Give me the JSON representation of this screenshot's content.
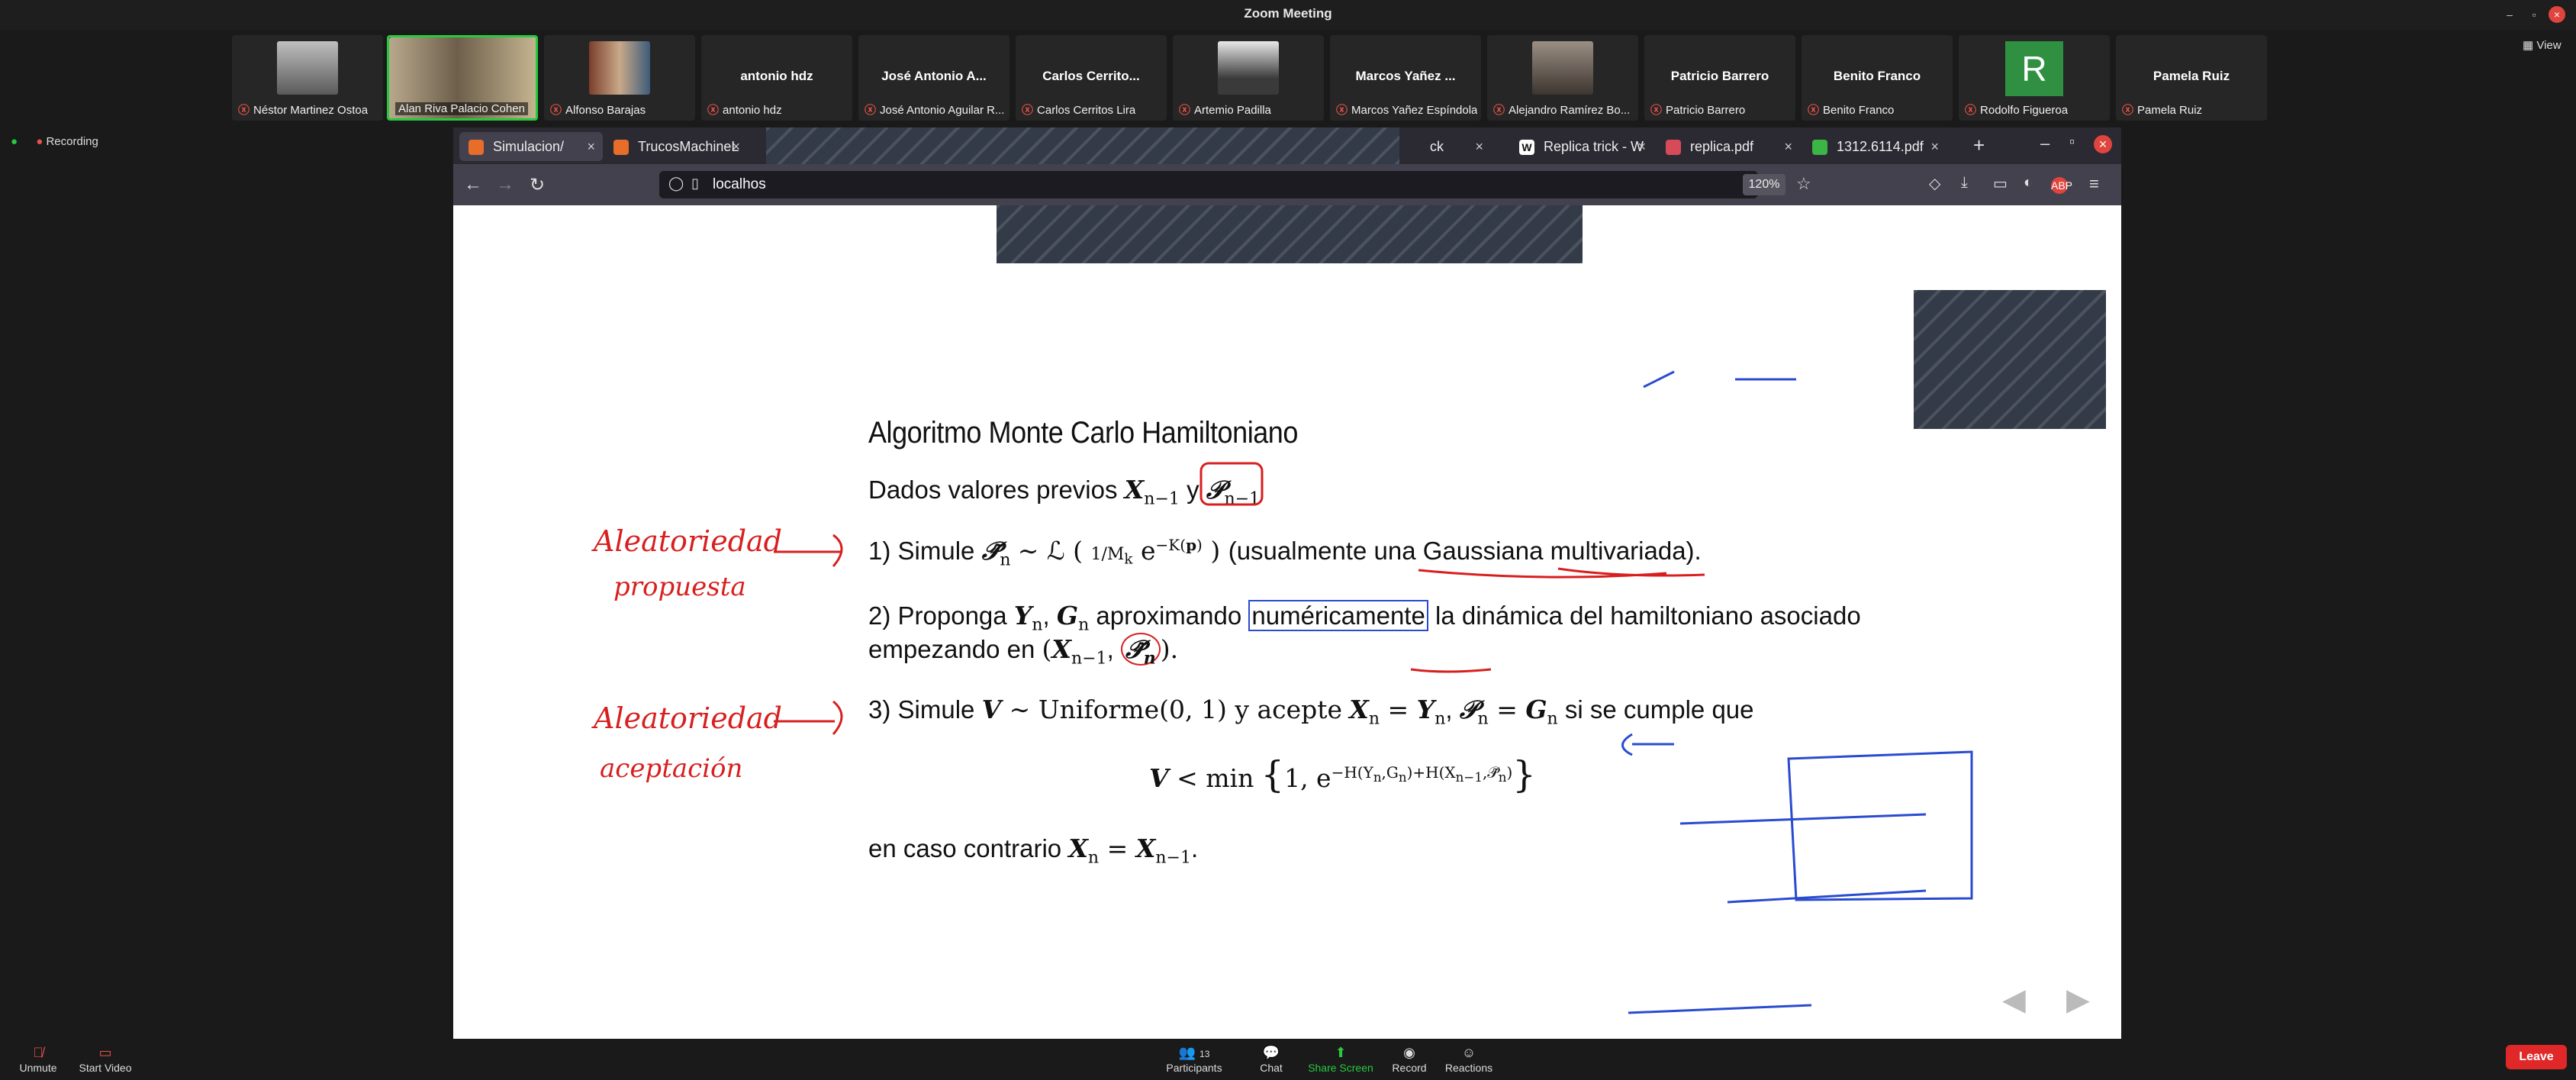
{
  "window": {
    "title": "Zoom Meeting"
  },
  "participants": [
    {
      "name": "Néstor Martinez Ostoa",
      "video": true,
      "muted": true
    },
    {
      "name": "Alan Riva Palacio Cohen",
      "video": true,
      "muted": false,
      "active": true
    },
    {
      "name": "Alfonso Barajas",
      "video": true,
      "muted": true
    },
    {
      "name": "antonio hdz",
      "video": false,
      "muted": true,
      "display_name": "antonio hdz"
    },
    {
      "name": "José Antonio Aguilar R...",
      "video": false,
      "muted": true,
      "display_name": "José Antonio A..."
    },
    {
      "name": "Carlos Cerritos Lira",
      "video": false,
      "muted": true,
      "display_name": "Carlos Cerrito..."
    },
    {
      "name": "Artemio Padilla",
      "video": true,
      "muted": true
    },
    {
      "name": "Marcos Yañez Espíndola",
      "video": false,
      "muted": true,
      "display_name": "Marcos Yañez ..."
    },
    {
      "name": "Alejandro Ramírez Bo...",
      "video": true,
      "muted": true
    },
    {
      "name": "Patricio Barrero",
      "video": false,
      "muted": true,
      "display_name": "Patricio Barrero"
    },
    {
      "name": "Benito Franco",
      "video": false,
      "muted": true,
      "display_name": "Benito Franco"
    },
    {
      "name": "Rodolfo Figueroa",
      "video": false,
      "muted": true,
      "avatar_letter": "R"
    },
    {
      "name": "Pamela Ruiz",
      "video": false,
      "muted": true,
      "display_name": "Pamela Ruiz"
    }
  ],
  "view_label": "View",
  "recording_label": "Recording",
  "browser": {
    "tabs": [
      {
        "label": "Simulacion/"
      },
      {
        "label": "TrucosMachineL"
      },
      {
        "label": "ck"
      },
      {
        "label": "Replica trick - W"
      },
      {
        "label": "replica.pdf"
      },
      {
        "label": "1312.6114.pdf"
      }
    ],
    "url": "localhos",
    "zoom": "120%"
  },
  "slide": {
    "title": "Algoritmo Monte Carlo Hamiltoniano",
    "given_prefix": "Dados valores previos",
    "given_and": "y",
    "step1_prefix": "1) Simule",
    "step1_suffix_a": "(usualmente una",
    "step1_suffix_b": "Gaussiana multivariada).",
    "step2_prefix": "2) Proponga",
    "step2_mid_a": "aproximando",
    "step2_boxed": "numéricamente",
    "step2_mid_b": "la dinámica del hamiltoniano asociado",
    "step2_line2": "empezando en",
    "step3_prefix": "3) Simule",
    "step3_dist": "Uniforme(0, 1) y acepte",
    "step3_suffix": "si se cumple que",
    "condition_min": "min",
    "else_prefix": "en caso contrario"
  },
  "annotations": {
    "red_1_line1": "Aleatoriedad",
    "red_1_line2": "propuesta",
    "red_2_line1": "Aleatoriedad",
    "red_2_line2": "aceptación"
  },
  "toolbar": {
    "unmute": "Unmute",
    "start_video": "Start Video",
    "participants": "Participants",
    "participants_count": "13",
    "chat": "Chat",
    "share_screen": "Share Screen",
    "record": "Record",
    "reactions": "Reactions",
    "leave": "Leave"
  },
  "colors": {
    "accent_green": "#27c93f",
    "leave_red": "#e02828",
    "ink_red": "#d81f1f",
    "ink_blue": "#2a4bd0"
  }
}
